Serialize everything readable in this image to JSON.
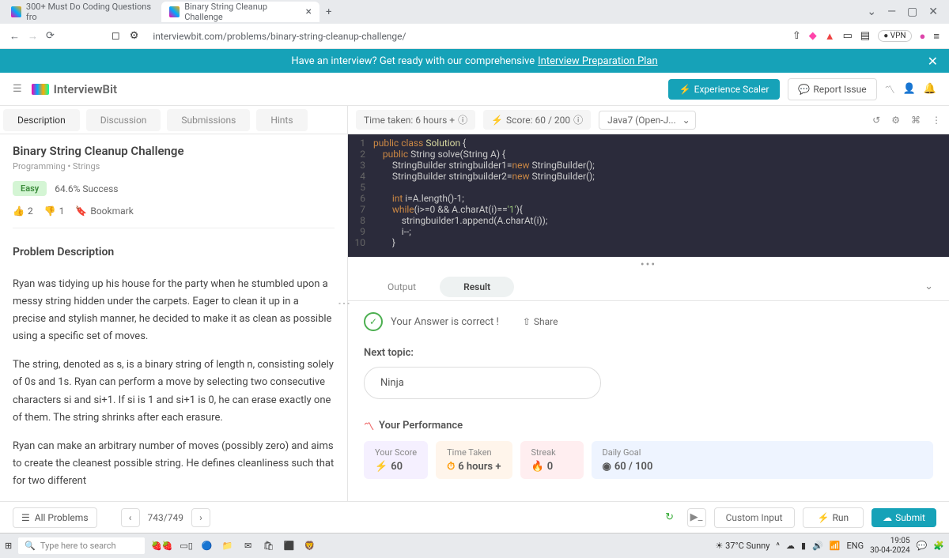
{
  "browser": {
    "tabs": [
      {
        "title": "300+ Must Do Coding Questions fro"
      },
      {
        "title": "Binary String Cleanup Challenge"
      }
    ],
    "url": "interviewbit.com/problems/binary-string-cleanup-challenge/",
    "vpn": "VPN"
  },
  "promo": {
    "text": "Have an interview? Get ready with our comprehensive",
    "link": "Interview Preparation Plan"
  },
  "header": {
    "logo": "InterviewBit",
    "scaler": "Experience Scaler",
    "report": "Report Issue"
  },
  "problem_tabs": [
    "Description",
    "Discussion",
    "Submissions",
    "Hints"
  ],
  "problem": {
    "title": "Binary String Cleanup Challenge",
    "meta": "Programming • Strings",
    "difficulty": "Easy",
    "success": "64.6% Success",
    "likes": "2",
    "dislikes": "1",
    "bookmark": "Bookmark",
    "section": "Problem Description",
    "para1": "Ryan was tidying up his house for the party when he stumbled upon a messy string hidden under the carpets. Eager to clean it up in a precise and stylish manner, he decided to make it as clean as possible using a specific set of moves.",
    "para2": "The string, denoted as s, is a binary string of length n, consisting solely of 0s and 1s. Ryan can perform a move by selecting two consecutive characters si and si+1. If si is 1 and si+1 is 0, he can erase exactly one of them. The string shrinks after each erasure.",
    "para3": "Ryan can make an arbitrary number of moves (possibly zero) and aims to create the cleanest possible string. He defines cleanliness such that for two different"
  },
  "toolbar": {
    "time": "Time taken: 6 hours +",
    "score": "Score:  60  /  200",
    "lang": "Java7 (Open-J..."
  },
  "code": {
    "l1": "public class Solution {",
    "l2": "    public String solve(String A) {",
    "l3": "        StringBuilder stringbuilder1=new StringBuilder();",
    "l4": "        StringBuilder stringbuilder2=new StringBuilder();",
    "l5": "",
    "l6": "        int i=A.length()-1;",
    "l7": "        while(i>=0 && A.charAt(i)=='1'){",
    "l8": "            stringbuilder1.append(A.charAt(i));",
    "l9": "            i--;",
    "l10": "        }"
  },
  "result": {
    "tabs": [
      "Output",
      "Result"
    ],
    "correct": "Your Answer is correct !",
    "share": "Share",
    "next_label": "Next topic:",
    "next_value": "Ninja",
    "perf_title": "Your Performance",
    "cards": {
      "score_label": "Your Score",
      "score_val": "60",
      "time_label": "Time Taken",
      "time_val": "6 hours +",
      "streak_label": "Streak",
      "streak_val": "0",
      "daily_label": "Daily Goal",
      "daily_val": "60 / 100"
    }
  },
  "footer": {
    "all": "All Problems",
    "page": "743/749",
    "custom": "Custom Input",
    "run": "Run",
    "submit": "Submit"
  },
  "taskbar": {
    "search": "Type here to search",
    "weather": "37°C Sunny",
    "lang": "ENG",
    "time": "19:05",
    "date": "30-04-2024"
  }
}
